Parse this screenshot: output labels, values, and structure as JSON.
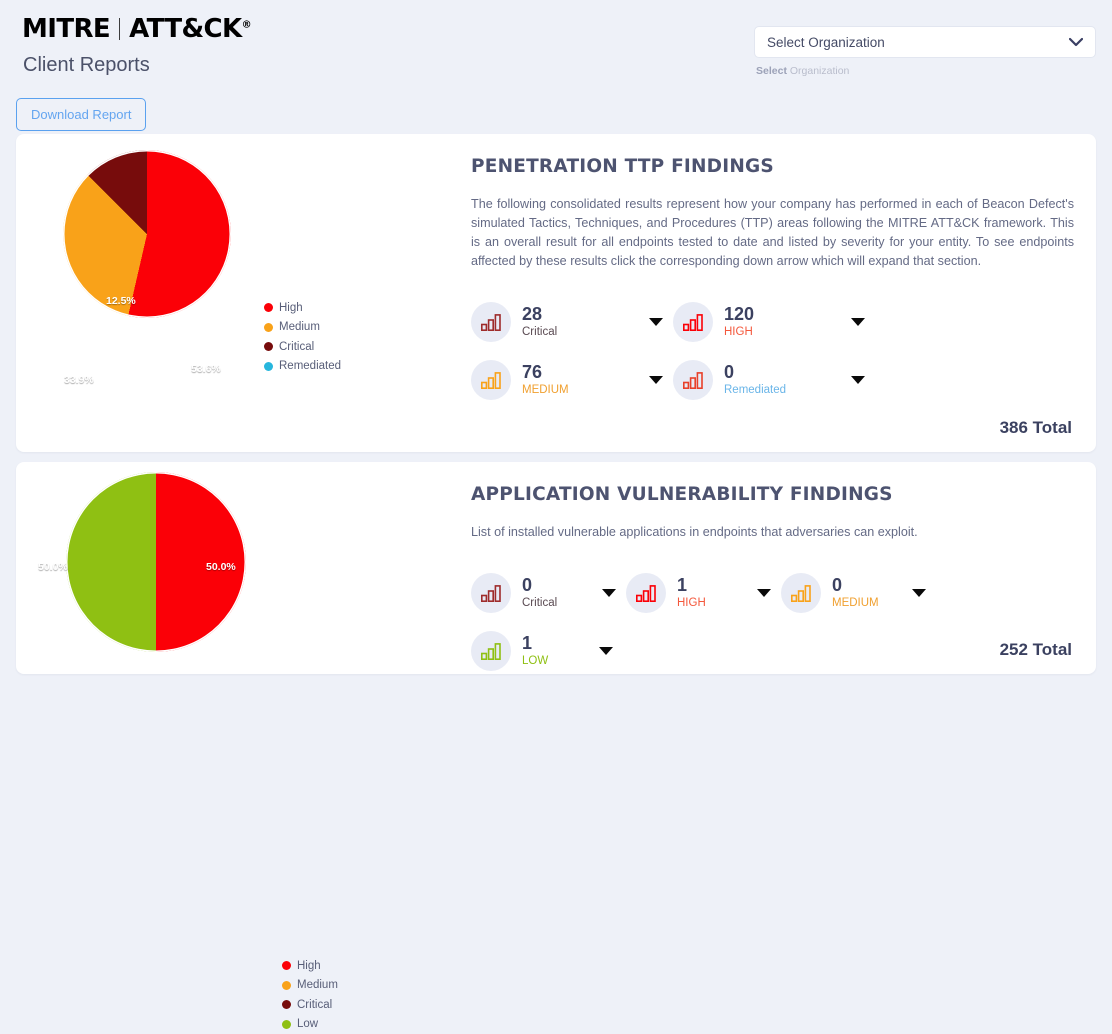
{
  "header": {
    "brand_mitre": "MITRE",
    "brand_attack": "ATT&CK",
    "brand_reg": "®",
    "page_title": "Client Reports",
    "download_label": "Download Report",
    "org_selected": "Select Organization",
    "org_help_bold": "Select",
    "org_help_rest": " Organization",
    "chevron_icon": "chevron-down-icon"
  },
  "colors": {
    "high": "#fb0007",
    "medium": "#f9a219",
    "critical": "#770c0c",
    "remediated": "#27b6dd",
    "low": "#8fc013",
    "page_bg": "#eef1f8",
    "card_bg": "#ffffff",
    "accent_blue": "#5aa1ef",
    "text_dark": "#3b4160"
  },
  "sections": [
    {
      "id": "ttp",
      "title": "PENETRATION TTP FINDINGS",
      "description": "The following consolidated results represent how your company has performed in each of Beacon Defect's simulated Tactics, Techniques, and Procedures (TTP) areas following the MITRE ATT&CK framework. This is an overall result for all endpoints tested to date and listed by severity for your entity. To see endpoints affected by these results click the corresponding down arrow which will expand that section.",
      "total": "386 Total",
      "legend": [
        {
          "label": "High",
          "color": "#fb0007"
        },
        {
          "label": "Medium",
          "color": "#f9a219"
        },
        {
          "label": "Critical",
          "color": "#770c0c"
        },
        {
          "label": "Remediated",
          "color": "#27b6dd"
        }
      ],
      "stats": [
        {
          "value": "28",
          "label": "Critical",
          "label_color": "#5a4a52",
          "icon": "bar-chart-icon",
          "icon_color": "#9e2b2b"
        },
        {
          "value": "120",
          "label": "HIGH",
          "label_color": "#f4583c",
          "icon": "bar-chart-icon",
          "icon_color": "#fb0007"
        },
        {
          "value": "76",
          "label": "MEDIUM",
          "label_color": "#f0a030",
          "icon": "bar-chart-icon",
          "icon_color": "#f9a219"
        },
        {
          "value": "0",
          "label": "Remediated",
          "label_color": "#6ab5e8",
          "icon": "bar-chart-icon",
          "icon_color": "#e8402a"
        }
      ]
    },
    {
      "id": "app",
      "title": "APPLICATION VULNERABILITY FINDINGS",
      "description": "List of installed vulnerable applications in endpoints that adversaries can exploit.",
      "total": "252 Total",
      "legend": [
        {
          "label": "High",
          "color": "#fb0007"
        },
        {
          "label": "Medium",
          "color": "#f9a219"
        },
        {
          "label": "Critical",
          "color": "#770c0c"
        },
        {
          "label": "Low",
          "color": "#8fc013"
        }
      ],
      "stats": [
        {
          "value": "0",
          "label": "Critical",
          "label_color": "#5a4a52",
          "icon": "bar-chart-icon",
          "icon_color": "#9e2b2b"
        },
        {
          "value": "1",
          "label": "HIGH",
          "label_color": "#f4583c",
          "icon": "bar-chart-icon",
          "icon_color": "#fb0007"
        },
        {
          "value": "0",
          "label": "MEDIUM",
          "label_color": "#f0a030",
          "icon": "bar-chart-icon",
          "icon_color": "#f9a219"
        },
        {
          "value": "1",
          "label": "LOW",
          "label_color": "#8fc013",
          "icon": "bar-chart-icon",
          "icon_color": "#8fc013"
        }
      ]
    }
  ],
  "chart_data": [
    {
      "type": "pie",
      "title": "PENETRATION TTP FINDINGS",
      "categories": [
        "High",
        "Medium",
        "Critical",
        "Remediated"
      ],
      "values": [
        53.6,
        33.9,
        12.5,
        0
      ],
      "value_unit": "%",
      "labels": [
        "53.6%",
        "33.9%",
        "12.5%",
        ""
      ],
      "colors": [
        "#fb0007",
        "#f9a219",
        "#770c0c",
        "#27b6dd"
      ],
      "legend_position": "right",
      "counts": [
        120,
        76,
        28,
        0
      ],
      "total": 386
    },
    {
      "type": "pie",
      "title": "APPLICATION VULNERABILITY FINDINGS",
      "categories": [
        "High",
        "Medium",
        "Critical",
        "Low"
      ],
      "values": [
        50.0,
        0,
        0,
        50.0
      ],
      "value_unit": "%",
      "labels": [
        "50.0%",
        "",
        "",
        "50.0%"
      ],
      "colors": [
        "#fb0007",
        "#f9a219",
        "#770c0c",
        "#8fc013"
      ],
      "legend_position": "right",
      "counts": [
        1,
        0,
        0,
        1
      ],
      "total": 252
    }
  ]
}
